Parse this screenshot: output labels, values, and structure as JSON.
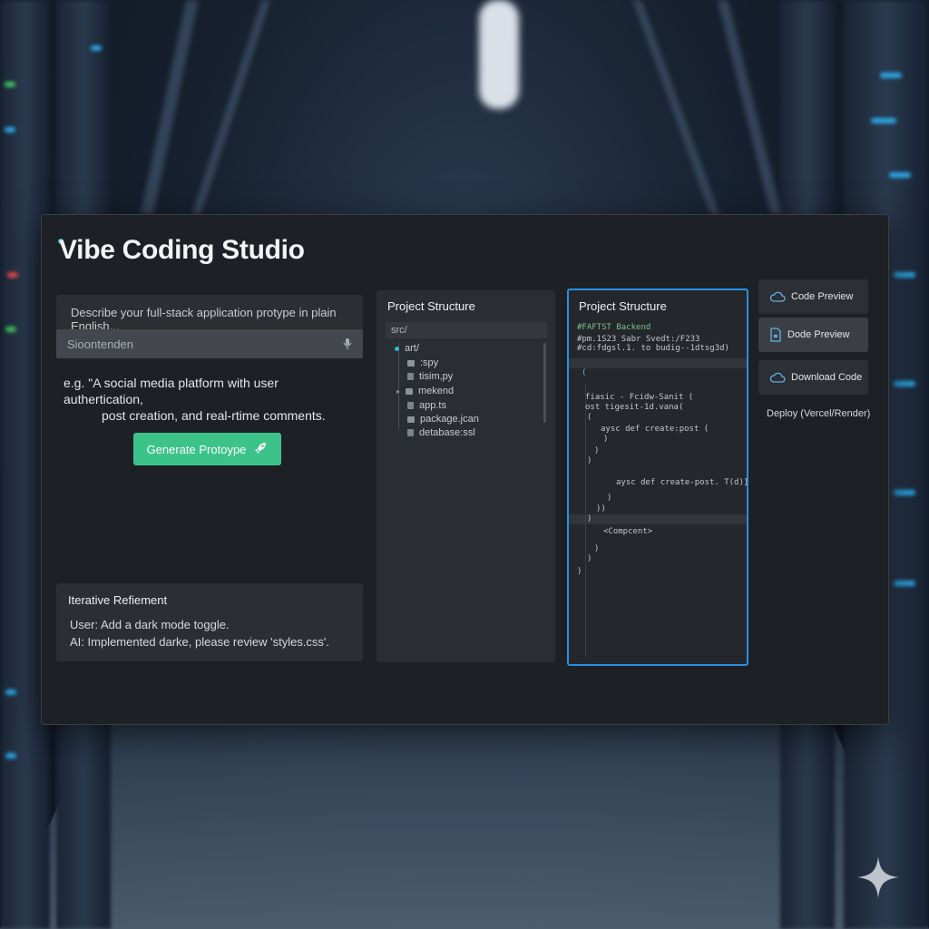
{
  "app": {
    "title": "Vibe Coding Studio"
  },
  "prompt": {
    "instruction": "Describe your full-stack application protype in plain English...",
    "input_value": "Sioontenden",
    "example_line1": "e.g. \"A social media platform with user authertication,",
    "example_line2": "post creation, and real-rtime comments.",
    "generate_label": "Generate Protoype"
  },
  "refinement": {
    "title": "Iterative Refiement",
    "lines": [
      "User: Add a dark mode toggle.",
      "AI:  Implemented darke, please review 'styles.css'."
    ]
  },
  "tree": {
    "title": "Project Structure",
    "root": "src/",
    "items": [
      "art/",
      ":spy",
      "tisim,py",
      "mekend",
      "app.ts",
      "package.jcan",
      "detabase:ssl"
    ]
  },
  "code": {
    "title": "Project Structure",
    "lines": [
      "#FAFTST Backend",
      "#pm.1S23 Sabr Svedt:/F233",
      "#cd:fdgsl.1. to budig--1dtsg3d)",
      "(",
      "fiasic - Fcidw-Sanit (",
      "ost tigesit-1d.vana(",
      "(",
      "aysc def create:post (",
      ")",
      ")",
      ")",
      "aysc def create-post. T(d)}",
      ")",
      "))",
      ")",
      "<Compcent>",
      ")",
      ")",
      ")"
    ]
  },
  "actions": {
    "code_preview": "Code Preview",
    "dode_preview": "Dode Preview",
    "download_code": "Download Code",
    "deploy": "Deploy (Vercel/Render)"
  },
  "colors": {
    "accent_green": "#3cc38a",
    "accent_blue": "#2a8fe0",
    "window_bg": "#1d2024"
  }
}
